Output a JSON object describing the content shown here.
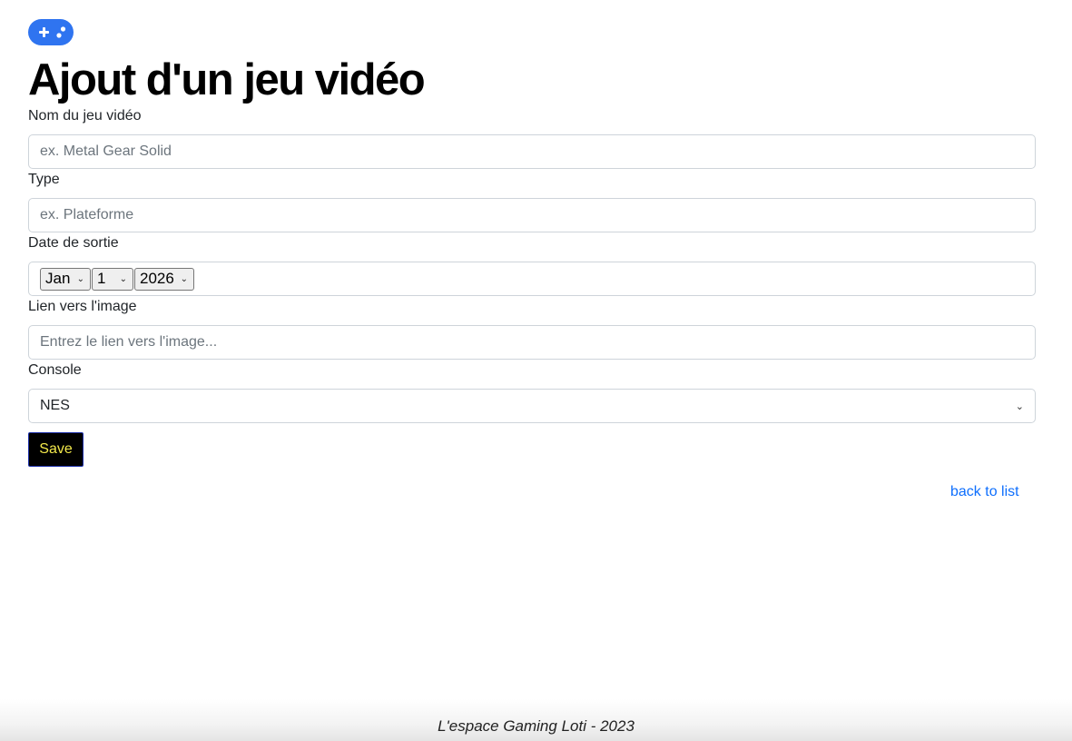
{
  "logo": {
    "icon": "gamepad-icon",
    "color": "#2f74f0"
  },
  "page": {
    "title": "Ajout d'un jeu vidéo"
  },
  "form": {
    "name": {
      "label": "Nom du jeu vidéo",
      "placeholder": "ex. Metal Gear Solid",
      "value": ""
    },
    "type": {
      "label": "Type",
      "placeholder": "ex. Plateforme",
      "value": ""
    },
    "release_date": {
      "label": "Date de sortie",
      "month": "Jan",
      "day": "1",
      "year": "2026"
    },
    "image_link": {
      "label": "Lien vers l'image",
      "placeholder": "Entrez le lien vers l'image...",
      "value": ""
    },
    "console": {
      "label": "Console",
      "selected": "NES"
    },
    "save_label": "Save"
  },
  "nav": {
    "back_label": "back to list",
    "link_color": "#0d6efd"
  },
  "footer": {
    "text": "L'espace Gaming Loti - 2023"
  }
}
